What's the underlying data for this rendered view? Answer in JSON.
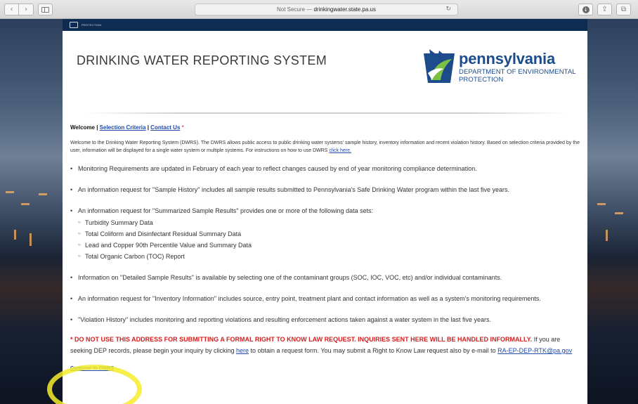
{
  "browser": {
    "url_prefix": "Not Secure —",
    "url_host": "drinkingwater.state.pa.us",
    "back_glyph": "‹",
    "forward_glyph": "›",
    "reload_glyph": "↻",
    "share_glyph": "⇪",
    "tabs_glyph": "⧉",
    "download_glyph": "↓"
  },
  "site": {
    "title": "DRINKING WATER REPORTING SYSTEM",
    "logo_name": "pennsylvania",
    "logo_dept": "DEPARTMENT OF ENVIRONMENTAL PROTECTION",
    "topbar_text": "PROTECTION"
  },
  "nav": {
    "welcome": "Welcome",
    "sep1": " | ",
    "selection_criteria": "Selection Criteria",
    "sep2": " | ",
    "contact_us": "Contact Us",
    "star": " *"
  },
  "intro": {
    "text": "Welcome to the Drinking Water Reporting System (DWRS). The DWRS allows public access to public drinking water systems' sample history, inventory information and recent violation history. Based on selection criteria provided by the user, information will be displayed for a single water system or multiple systems. For instructions on how to use DWRS ",
    "link": "click here."
  },
  "bullets": {
    "b1": "Monitoring Requirements are updated in February of each year to reflect changes caused by end of year monitoring compliance determination.",
    "b2": "An information request for \"Sample History\" includes all sample results submitted to Pennsylvania's Safe Drinking Water program within the last five years.",
    "b3": "An information request for \"Summarized Sample Results\" provides one or more of the following data sets:",
    "b3_sub": [
      "Turbidity Summary Data",
      "Total Coliform and Disinfectant Residual Summary Data",
      "Lead and Copper 90th Percentile Value and Summary Data",
      "Total Organic Carbon (TOC) Report"
    ],
    "b4": "Information on \"Detailed Sample Results\" is available by selecting one of the contaminant groups (SOC, IOC, VOC, etc) and/or individual contaminants.",
    "b5": "An information request for \"Inventory Information\" includes source, entry point, treatment plant and contact information as well as a system's monitoring requirements.",
    "b6": "\"Violation History\" includes monitoring and reporting violations and resulting enforcement actions taken against a water system in the last five years."
  },
  "notice": {
    "warning": "* DO NOT USE THIS ADDRESS FOR SUBMITTING A FORMAL RIGHT TO KNOW LAW REQUEST. INQUIRIES SENT HERE WILL BE HANDLED INFORMALLY.",
    "text1": " If you are seeking DEP records, please begin your inquiry by clicking ",
    "here_link": "here",
    "text2": " to obtain a request form. You may submit a Right to Know Law request also by e-mail to ",
    "email": "RA-EP-DEP-RTK@pa.gov"
  },
  "continue_link": "Continue to DWRS",
  "colors": {
    "link": "#1f4aa8",
    "warning": "#d41e1e",
    "brand": "#1c4c8c",
    "highlight": "#f6ec2a"
  }
}
